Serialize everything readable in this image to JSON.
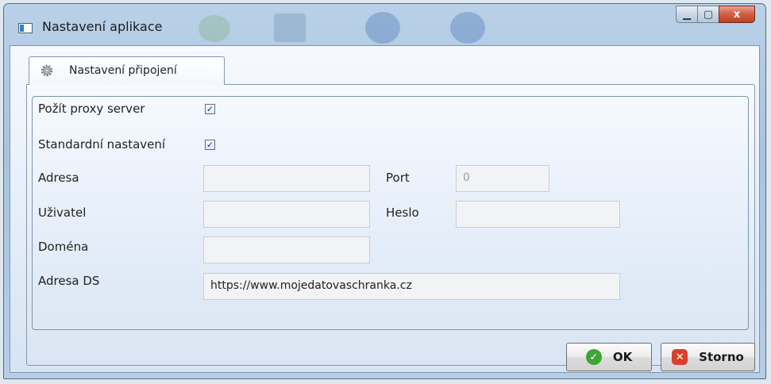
{
  "window": {
    "title": "Nastavení aplikace",
    "controls": {
      "minimize_glyph": "▁",
      "maximize_glyph": "▢",
      "close_glyph": "x"
    }
  },
  "tab": {
    "label": "Nastavení připojení",
    "icon": "gear-icon"
  },
  "form": {
    "use_proxy": {
      "label": "Požít proxy server",
      "checked": true,
      "glyph": "✓"
    },
    "default_settings": {
      "label": "Standardní nastavení",
      "checked": true,
      "glyph": "✓"
    },
    "address": {
      "label": "Adresa",
      "value": ""
    },
    "port": {
      "label": "Port",
      "value": "0"
    },
    "user": {
      "label": "Uživatel",
      "value": ""
    },
    "password": {
      "label": "Heslo",
      "value": ""
    },
    "domain": {
      "label": "Doména",
      "value": ""
    },
    "ds_address": {
      "label": "Adresa DS",
      "value": "https://www.mojedatovaschranka.cz"
    }
  },
  "buttons": {
    "ok": {
      "label": "OK",
      "icon": "check-circle-icon",
      "color": "#3fa535",
      "glyph": "✓"
    },
    "cancel": {
      "label": "Storno",
      "icon": "cancel-icon",
      "color": "#d8412b",
      "glyph": "✕"
    }
  }
}
